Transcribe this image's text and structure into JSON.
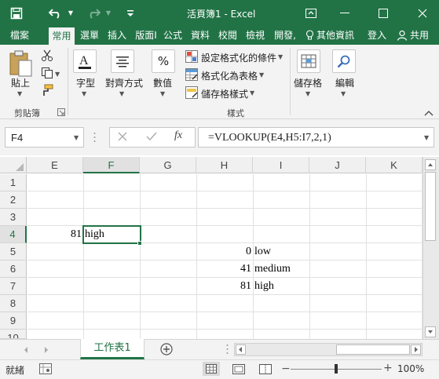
{
  "title_bar": {
    "title": "活頁簿1 - Excel",
    "icons": [
      "save-icon",
      "undo-icon",
      "redo-icon",
      "customize-qat-icon",
      "ribbon-display-options-icon",
      "minimize-icon",
      "restore-icon",
      "close-icon"
    ]
  },
  "ribbon_tabs": {
    "items": [
      "檔案",
      "常用",
      "選單",
      "插入",
      "版面I",
      "公式",
      "資料",
      "校閱",
      "檢視",
      "開發,"
    ],
    "active": "常用",
    "tell_me": "其他資訊",
    "signin": "登入",
    "share": "共用"
  },
  "ribbon": {
    "paste": "貼上",
    "font": "字型",
    "alignment": "對齊方式",
    "number": "數值",
    "conditional_formatting": "設定格式化的條件",
    "format_as_table": "格式化為表格",
    "cell_styles": "儲存格樣式",
    "cells": "儲存格",
    "editing": "編輯",
    "group_clipboard": "剪貼簿",
    "group_styles": "樣式",
    "number_symbol": "%"
  },
  "formula_bar": {
    "name_box": "F4",
    "formula": "=VLOOKUP(E4,H5:I7,2,1)",
    "fx": "fx"
  },
  "grid": {
    "columns": [
      "E",
      "F",
      "G",
      "H",
      "I",
      "J",
      "K"
    ],
    "rows": [
      "1",
      "2",
      "3",
      "4",
      "5",
      "6",
      "7",
      "8",
      "9",
      "10"
    ],
    "selected_column": "F",
    "selected_row": "4",
    "cells": {
      "E4": "81",
      "F4": "high",
      "H5": "0",
      "I5": "low",
      "H6": "41",
      "I6": "medium",
      "H7": "81",
      "I7": "high"
    }
  },
  "sheets": {
    "tabs": [
      "工作表1"
    ],
    "active": "工作表1"
  },
  "status_bar": {
    "mode": "就緒",
    "zoom": "100%"
  },
  "colors": {
    "excel_green": "#217346",
    "ribbon_bg": "#f3f3f3"
  }
}
